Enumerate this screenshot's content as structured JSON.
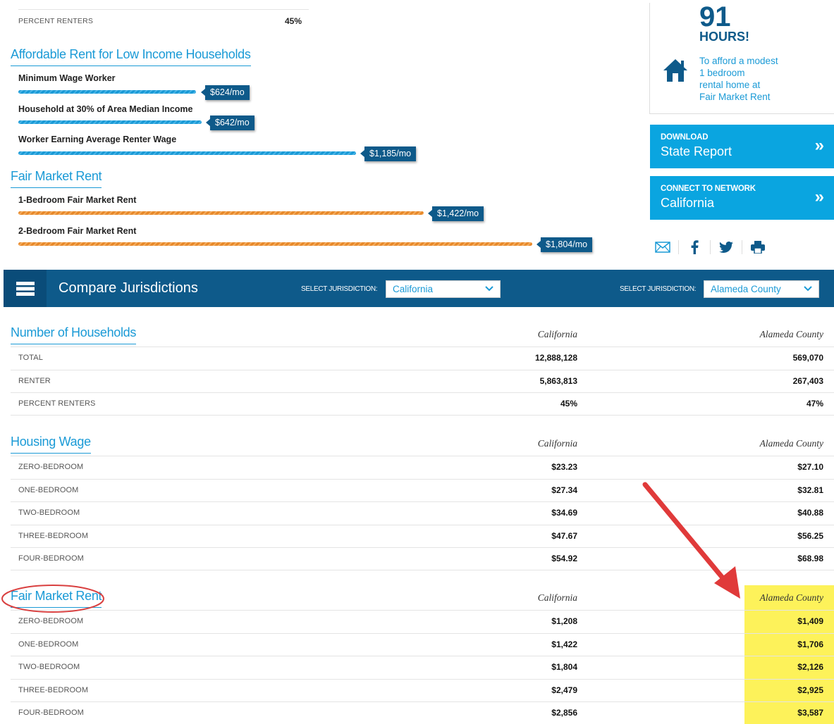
{
  "top": {
    "percent_renters_label": "PERCENT RENTERS",
    "percent_renters_value": "45%",
    "affordable_title": "Affordable Rent for Low Income Households",
    "affordable_bars": [
      {
        "label": "Minimum Wage Worker",
        "value": "$624/mo",
        "amount": 624
      },
      {
        "label": "Household at 30% of Area Median Income",
        "value": "$642/mo",
        "amount": 642
      },
      {
        "label": "Worker Earning Average Renter Wage",
        "value": "$1,185/mo",
        "amount": 1185
      }
    ],
    "fmr_title": "Fair Market Rent",
    "fmr_bars": [
      {
        "label": "1-Bedroom Fair Market Rent",
        "value": "$1,422/mo",
        "amount": 1422
      },
      {
        "label": "2-Bedroom Fair Market Rent",
        "value": "$1,804/mo",
        "amount": 1804
      }
    ]
  },
  "hours_card": {
    "number": "91",
    "word": "HOURS!",
    "description_lines": [
      "To afford a modest",
      "1 bedroom",
      "rental home at",
      "Fair Market Rent"
    ],
    "icon": "house-icon"
  },
  "cta_download": {
    "small": "DOWNLOAD",
    "big": "State Report",
    "chevron": "»"
  },
  "cta_network": {
    "small": "CONNECT TO NETWORK",
    "big": "California",
    "chevron": "»"
  },
  "share_icons": [
    "email-icon",
    "facebook-icon",
    "twitter-icon",
    "print-icon"
  ],
  "compare": {
    "title": "Compare Jurisdictions",
    "select_label_1": "SELECT JURISDICTION:",
    "select_value_1": "California",
    "select_label_2": "SELECT JURISDICTION:",
    "select_value_2": "Alameda County"
  },
  "tables": {
    "households": {
      "title": "Number of Households",
      "col1": "California",
      "col2": "Alameda County",
      "rows": [
        {
          "label": "TOTAL",
          "v1": "12,888,128",
          "v2": "569,070"
        },
        {
          "label": "RENTER",
          "v1": "5,863,813",
          "v2": "267,403"
        },
        {
          "label": "PERCENT RENTERS",
          "v1": "45%",
          "v2": "47%"
        }
      ]
    },
    "housing_wage": {
      "title": "Housing Wage",
      "col1": "California",
      "col2": "Alameda County",
      "rows": [
        {
          "label": "ZERO-BEDROOM",
          "v1": "$23.23",
          "v2": "$27.10"
        },
        {
          "label": "ONE-BEDROOM",
          "v1": "$27.34",
          "v2": "$32.81"
        },
        {
          "label": "TWO-BEDROOM",
          "v1": "$34.69",
          "v2": "$40.88"
        },
        {
          "label": "THREE-BEDROOM",
          "v1": "$47.67",
          "v2": "$56.25"
        },
        {
          "label": "FOUR-BEDROOM",
          "v1": "$54.92",
          "v2": "$68.98"
        }
      ]
    },
    "fair_market_rent": {
      "title": "Fair Market Rent",
      "col1": "California",
      "col2": "Alameda County",
      "rows": [
        {
          "label": "ZERO-BEDROOM",
          "v1": "$1,208",
          "v2": "$1,409"
        },
        {
          "label": "ONE-BEDROOM",
          "v1": "$1,422",
          "v2": "$1,706"
        },
        {
          "label": "TWO-BEDROOM",
          "v1": "$1,804",
          "v2": "$2,126"
        },
        {
          "label": "THREE-BEDROOM",
          "v1": "$2,479",
          "v2": "$2,925"
        },
        {
          "label": "FOUR-BEDROOM",
          "v1": "$2,856",
          "v2": "$3,587"
        }
      ]
    }
  },
  "colors": {
    "brand_blue": "#0e5a8a",
    "accent_blue": "#1a9ad6",
    "cta_blue": "#0aa5e0",
    "bar_orange": "#e8892a",
    "highlight_yellow": "#fdf25a",
    "annotation_red": "#e03a3a"
  }
}
